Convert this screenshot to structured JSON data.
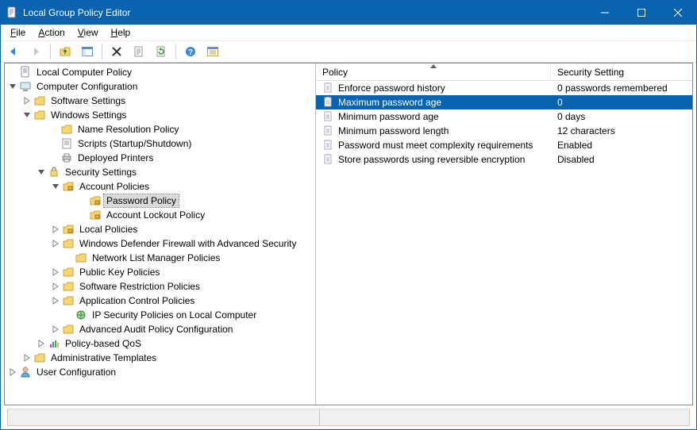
{
  "window": {
    "title": "Local Group Policy Editor"
  },
  "menubar": {
    "file": {
      "u": "F",
      "rest": "ile"
    },
    "action": {
      "u": "A",
      "rest": "ction"
    },
    "view": {
      "u": "V",
      "rest": "iew"
    },
    "help": {
      "u": "H",
      "rest": "elp"
    }
  },
  "tree": {
    "root": "Local Computer Policy",
    "cc": "Computer Configuration",
    "ss": "Software Settings",
    "ws": "Windows Settings",
    "nrp": "Name Resolution Policy",
    "scripts": "Scripts (Startup/Shutdown)",
    "dp": "Deployed Printers",
    "secset": "Security Settings",
    "acctpol": "Account Policies",
    "pwdpol": "Password Policy",
    "lockpol": "Account Lockout Policy",
    "localpol": "Local Policies",
    "wdf": "Windows Defender Firewall with Advanced Security",
    "nlm": "Network List Manager Policies",
    "pkp": "Public Key Policies",
    "srp": "Software Restriction Policies",
    "acp": "Application Control Policies",
    "ipsec": "IP Security Policies on Local Computer",
    "aapc": "Advanced Audit Policy Configuration",
    "pqos": "Policy-based QoS",
    "atmpl": "Administrative Templates",
    "uc": "User Configuration"
  },
  "list": {
    "headers": {
      "policy": "Policy",
      "setting": "Security Setting"
    },
    "rows": [
      {
        "policy": "Enforce password history",
        "setting": "0 passwords remembered"
      },
      {
        "policy": "Maximum password age",
        "setting": "0"
      },
      {
        "policy": "Minimum password age",
        "setting": "0 days"
      },
      {
        "policy": "Minimum password length",
        "setting": "12 characters"
      },
      {
        "policy": "Password must meet complexity requirements",
        "setting": "Enabled"
      },
      {
        "policy": "Store passwords using reversible encryption",
        "setting": "Disabled"
      }
    ],
    "selected_index": 1
  }
}
